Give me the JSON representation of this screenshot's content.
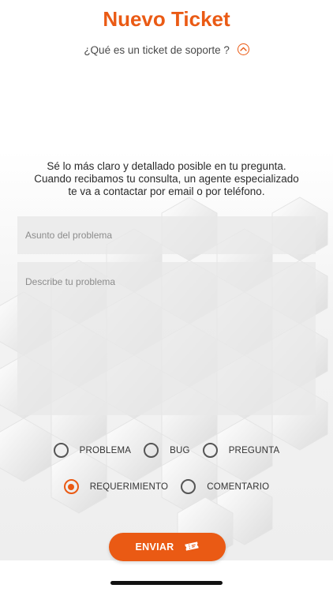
{
  "header": {
    "title": "Nuevo Ticket",
    "subtitle": "¿Qué es un ticket de soporte ?",
    "subtitle_icon": "chevron-up-circle-icon"
  },
  "intro_text": "Sé lo más claro y detallado posible en tu pregunta. Cuando recibamos tu consulta, un agente especializado te va a contactar por email o por teléfono.",
  "form": {
    "subject_placeholder": "Asunto del problema",
    "description_placeholder": "Describe tu problema"
  },
  "categories": {
    "row1": [
      {
        "label": "PROBLEMA",
        "checked": false
      },
      {
        "label": "BUG",
        "checked": false
      },
      {
        "label": "PREGUNTA",
        "checked": false
      }
    ],
    "row2": [
      {
        "label": "REQUERIMIENTO",
        "checked": true
      },
      {
        "label": "COMENTARIO",
        "checked": false
      }
    ]
  },
  "send_button": {
    "label": "ENVIAR",
    "icon": "ticket-icon"
  },
  "colors": {
    "accent": "#ea5a14",
    "text": "#2b2b2b",
    "field_bg": "#e8e8e8"
  }
}
